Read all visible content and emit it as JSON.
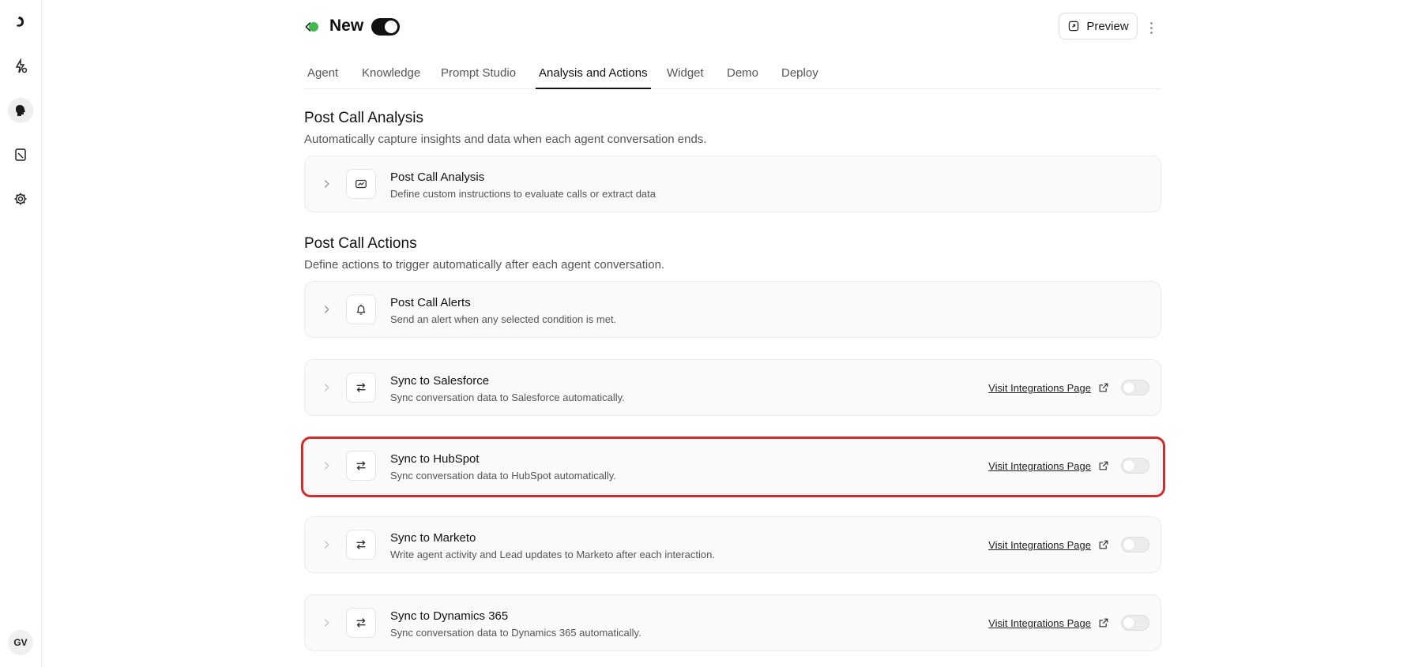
{
  "sidebar": {
    "items": [
      {
        "icon": "logo-icon"
      },
      {
        "icon": "bolt-agent-icon"
      },
      {
        "icon": "agent-head-icon",
        "active": true
      },
      {
        "icon": "document-icon"
      },
      {
        "icon": "gear-icon"
      }
    ],
    "avatar_initials": "GV"
  },
  "header": {
    "agent_name": "New",
    "status_color": "#3fb950",
    "active": true,
    "preview_label": "Preview"
  },
  "tabs": [
    {
      "label": "Agent"
    },
    {
      "label": "Knowledge"
    },
    {
      "label": "Prompt Studio"
    },
    {
      "label": "Analysis and Actions",
      "active": true
    },
    {
      "label": "Widget"
    },
    {
      "label": "Demo"
    },
    {
      "label": "Deploy"
    }
  ],
  "analysis": {
    "title": "Post Call Analysis",
    "description": "Automatically capture insights and data when each agent conversation ends.",
    "card": {
      "title": "Post Call Analysis",
      "description": "Define custom instructions to evaluate calls or extract data",
      "icon": "chart-card-icon"
    }
  },
  "actions": {
    "title": "Post Call Actions",
    "description": "Define actions to trigger automatically after each agent conversation.",
    "alerts_card": {
      "title": "Post Call Alerts",
      "description": "Send an alert when any selected condition is met.",
      "icon": "bell-icon"
    },
    "integrations": [
      {
        "title": "Sync to Salesforce",
        "description": "Sync conversation data to Salesforce automatically.",
        "link_label": "Visit Integrations Page",
        "enabled": false
      },
      {
        "title": "Sync to HubSpot",
        "description": "Sync conversation data to HubSpot automatically.",
        "link_label": "Visit Integrations Page",
        "enabled": false,
        "highlighted": true
      },
      {
        "title": "Sync to Marketo",
        "description": "Write agent activity and Lead updates to Marketo after each interaction.",
        "link_label": "Visit Integrations Page",
        "enabled": false
      },
      {
        "title": "Sync to Dynamics 365",
        "description": "Sync conversation data to Dynamics 365 automatically.",
        "link_label": "Visit Integrations Page",
        "enabled": false
      }
    ]
  },
  "colors": {
    "highlight": "#d42a2a",
    "accent": "#111111"
  }
}
